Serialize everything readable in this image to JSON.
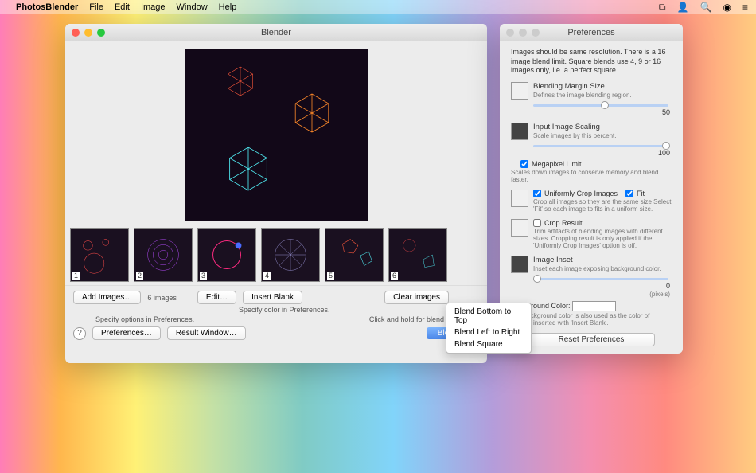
{
  "menubar": {
    "app": "PhotosBlender",
    "items": [
      "File",
      "Edit",
      "Image",
      "Window",
      "Help"
    ]
  },
  "blender_window": {
    "title": "Blender",
    "thumb_count": 6,
    "add_images": "Add Images…",
    "image_count_label": "6 images",
    "edit": "Edit…",
    "insert_blank": "Insert Blank",
    "clear": "Clear images",
    "specify_color": "Specify color in Preferences.",
    "specify_opts": "Specify options in Preferences.",
    "click_hold": "Click and hold for blend options.",
    "prefs_btn": "Preferences…",
    "result_btn": "Result Window…",
    "blend_btn": "Blend",
    "blend_menu": [
      "Blend Bottom to Top",
      "Blend Left to Right",
      "Blend Square"
    ]
  },
  "prefs_window": {
    "title": "Preferences",
    "intro": "Images should be same resolution. There is a 16 image blend limit. Square blends use 4, 9 or 16 images only, i.e. a perfect square.",
    "margin_lbl": "Blending Margin Size",
    "margin_desc": "Defines the image blending region.",
    "margin_val": "50",
    "scale_lbl": "Input Image Scaling",
    "scale_desc": "Scale images by this percent.",
    "scale_val": "100",
    "mp_lbl": "Megapixel Limit",
    "mp_desc": "Scales down images to conserve memory and blend faster.",
    "crop_lbl": "Uniformly Crop Images",
    "fit_lbl": "Fit",
    "crop_desc": "Crop all images so they are the same size Select 'Fit' so each image to fits in a uniform size.",
    "cropres_lbl": "Crop Result",
    "cropres_desc": "Trim artifacts of blending images with different sizes. Cropping result is only applied if the 'Uniformly Crop Images' option is off.",
    "inset_lbl": "Image Inset",
    "inset_desc": "Inset each image exposing background color.",
    "inset_val": "0",
    "inset_unit": "(pixels)",
    "bg_lbl": "Background Color:",
    "bg_desc": "The background color is also used as the color of images inserted with 'Insert Blank'.",
    "reset": "Reset Preferences"
  }
}
